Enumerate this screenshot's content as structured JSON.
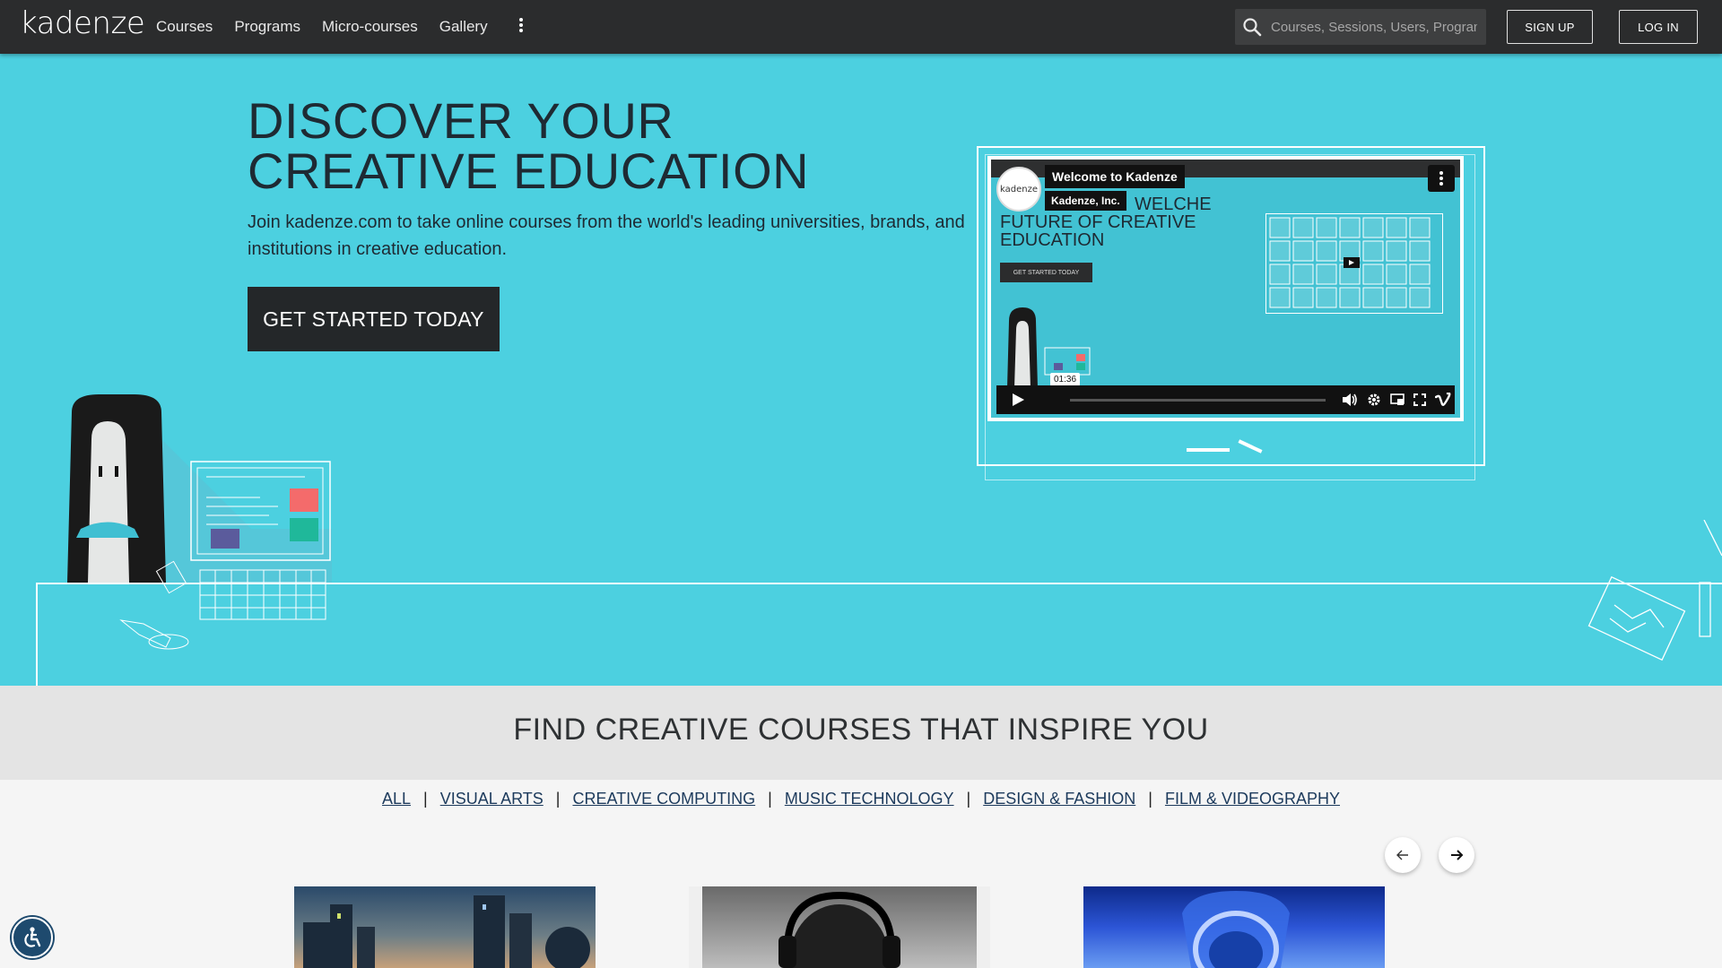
{
  "header": {
    "logo": "kadenze",
    "nav": [
      "Courses",
      "Programs",
      "Micro-courses",
      "Gallery"
    ],
    "search_placeholder": "Courses, Sessions, Users, Programs",
    "signup_label": "SIGN UP",
    "login_label": "LOG IN"
  },
  "hero": {
    "title": "DISCOVER YOUR CREATIVE EDUCATION",
    "subtitle": "Join kadenze.com to take online courses from the world's leading universities, brands, and institutions in creative education.",
    "cta_label": "GET STARTED TODAY"
  },
  "video": {
    "channel_logo": "kadenze",
    "title": "Welcome to Kadenze",
    "author": "Kadenze, Inc.",
    "headline_start": "WELC",
    "headline_rest": "HE FUTURE OF CREATIVE EDUCATION",
    "inner_button": "GET STARTED TODAY",
    "timestamp": "01:36"
  },
  "courses": {
    "title": "FIND CREATIVE COURSES THAT INSPIRE YOU",
    "categories": [
      "ALL",
      "VISUAL ARTS",
      "CREATIVE COMPUTING",
      "MUSIC TECHNOLOGY",
      "DESIGN & FASHION",
      "FILM & VIDEOGRAPHY"
    ]
  },
  "colors": {
    "hero_bg": "#4cd0e0",
    "header_bg": "#2b2c2d",
    "cta_bg": "#242729",
    "link": "#1c3a5c"
  },
  "icons": {
    "search": "search-icon",
    "more": "vertical-dots-icon",
    "prev": "arrow-left-icon",
    "next": "arrow-right-icon",
    "accessibility": "accessibility-icon"
  }
}
